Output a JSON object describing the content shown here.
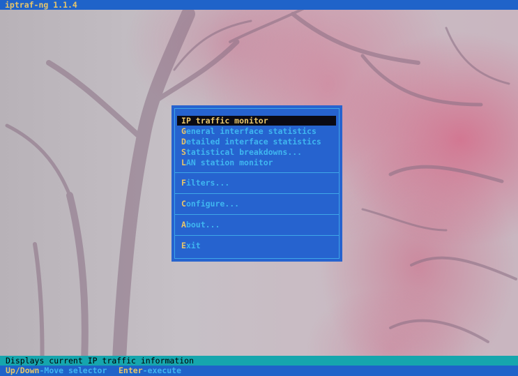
{
  "title_bar": {
    "text": "iptraf-ng 1.1.4"
  },
  "menu": {
    "groups": [
      {
        "items": [
          {
            "hotkey": "I",
            "rest": "P traffic monitor",
            "selected": true
          },
          {
            "hotkey": "G",
            "rest": "eneral interface statistics",
            "selected": false
          },
          {
            "hotkey": "D",
            "rest": "etailed interface statistics",
            "selected": false
          },
          {
            "hotkey": "S",
            "rest": "tatistical breakdowns...",
            "selected": false
          },
          {
            "hotkey": "L",
            "rest": "AN station monitor",
            "selected": false
          }
        ]
      },
      {
        "items": [
          {
            "hotkey": "F",
            "rest": "ilters...",
            "selected": false
          }
        ]
      },
      {
        "items": [
          {
            "hotkey": "C",
            "rest": "onfigure...",
            "selected": false
          }
        ]
      },
      {
        "items": [
          {
            "hotkey": "A",
            "rest": "bout...",
            "selected": false
          }
        ]
      },
      {
        "items": [
          {
            "hotkey": "E",
            "rest": "xit",
            "selected": false
          }
        ]
      }
    ]
  },
  "status_bar": {
    "text": "Displays current IP traffic information"
  },
  "help_bar": {
    "keys": [
      {
        "key": "Up/Down",
        "desc": "-Move selector"
      },
      {
        "key": "Enter",
        "desc": "-execute"
      }
    ]
  },
  "colors": {
    "title_bg": "#1f63c9",
    "menu_bg": "#2663cf",
    "menu_text": "#3fb6f0",
    "hotkey": "#e8c66a",
    "selection_bg": "#0a0a14",
    "status_bg": "#16a6ad"
  }
}
